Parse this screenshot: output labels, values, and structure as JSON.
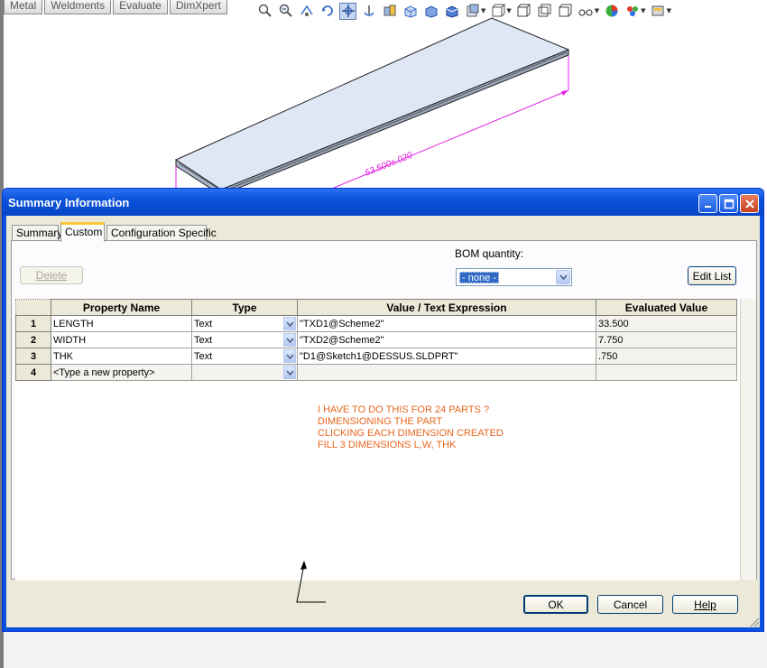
{
  "cm_tabs": [
    "Metal",
    "Weldments",
    "Evaluate",
    "DimXpert"
  ],
  "view_toolbar": {
    "icons": [
      "zoom-to-fit-icon",
      "zoom-to-area-icon",
      "previous-view-icon",
      "rotate-view-icon",
      "pan-icon",
      "dynamic-annotation-icon",
      "section-view-icon",
      "view-orientation-icon",
      "display-style-icon",
      "shaded-icon",
      "hide-show-icon",
      "view-cube-icon",
      "standard-views-icon",
      "box-view-icon",
      "wireframe-icon",
      "eyeglasses-icon",
      "appearance-icon",
      "scene-icon",
      "view-settings-icon"
    ]
  },
  "model": {
    "dimension_label": "53.500±.020"
  },
  "dialog": {
    "title": "Summary Information",
    "tabs": [
      "Summary",
      "Custom",
      "Configuration Specific"
    ],
    "selected_tab": "Custom",
    "delete_label": "Delete",
    "bom_label": "BOM quantity:",
    "bom_value": "- none -",
    "edit_list_label": "Edit List",
    "columns": [
      "",
      "Property Name",
      "Type",
      "Value / Text Expression",
      "Evaluated Value"
    ],
    "rows": [
      {
        "num": "1",
        "name": "LENGTH",
        "type": "Text",
        "value": "\"TXD1@Scheme2\"",
        "evaluated": "33.500"
      },
      {
        "num": "2",
        "name": "WIDTH",
        "type": "Text",
        "value": "\"TXD2@Scheme2\"",
        "evaluated": "7.750"
      },
      {
        "num": "3",
        "name": "THK",
        "type": "Text",
        "value": "\"D1@Sketch1@DESSUS.SLDPRT\"",
        "evaluated": ".750"
      },
      {
        "num": "4",
        "name": "<Type a new property>",
        "type": "",
        "value": "",
        "evaluated": ""
      }
    ],
    "note_lines": [
      "I HAVE TO DO THIS FOR 24 PARTS ?",
      "DIMENSIONING THE PART",
      "CLICKING EACH DIMENSION CREATED",
      "FILL 3 DIMENSIONS L,W, THK"
    ],
    "ok_label": "OK",
    "cancel_label": "Cancel",
    "help_label": "Help",
    "colors": {
      "title_bar": "#0a52dc",
      "note": "#e8661e",
      "dimension": "#e020e0"
    }
  }
}
